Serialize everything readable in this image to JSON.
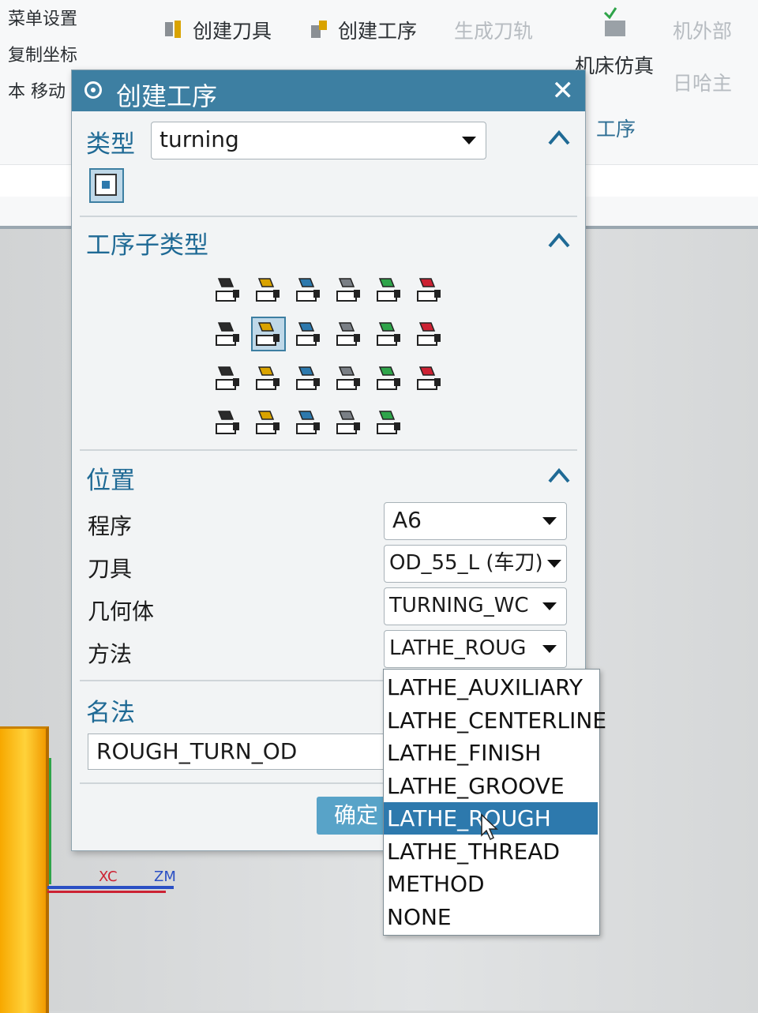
{
  "ribbon": {
    "left_items": [
      "菜单设置",
      "复制坐标",
      "本 移动"
    ],
    "create_tool": "创建刀具",
    "create_operation": "创建工序",
    "generate_toolpath": "生成刀轨",
    "machine_sim": "机床仿真",
    "ops_group": "工序",
    "right_top": "机外部",
    "right_bottom": "日哈主"
  },
  "dialog": {
    "title": "创建工序",
    "type_section": {
      "label": "类型",
      "value": "turning"
    },
    "subtype_section": {
      "label": "工序子类型",
      "selected_index": 7
    },
    "location_section": {
      "label": "位置",
      "fields": [
        {
          "label": "程序",
          "value": "A6"
        },
        {
          "label": "刀具",
          "value": "OD_55_L (车刀)"
        },
        {
          "label": "几何体",
          "value": "TURNING_WC"
        },
        {
          "label": "方法",
          "value": "LATHE_ROUG"
        }
      ]
    },
    "name_section": {
      "label": "名法",
      "value": "ROUGH_TURN_OD"
    },
    "ok_label": "确定"
  },
  "method_dropdown": {
    "options": [
      "LATHE_AUXILIARY",
      "LATHE_CENTERLINE",
      "LATHE_FINISH",
      "LATHE_GROOVE",
      "LATHE_ROUGH",
      "LATHE_THREAD",
      "METHOD",
      "NONE"
    ],
    "selected": "LATHE_ROUGH"
  },
  "viewport": {
    "axis_x": "XC",
    "axis_zm": "ZM"
  },
  "colors": {
    "accent": "#3d7fa2",
    "section_text": "#1f6a95",
    "selection": "#2d79ad",
    "part": "#ffc21a"
  }
}
